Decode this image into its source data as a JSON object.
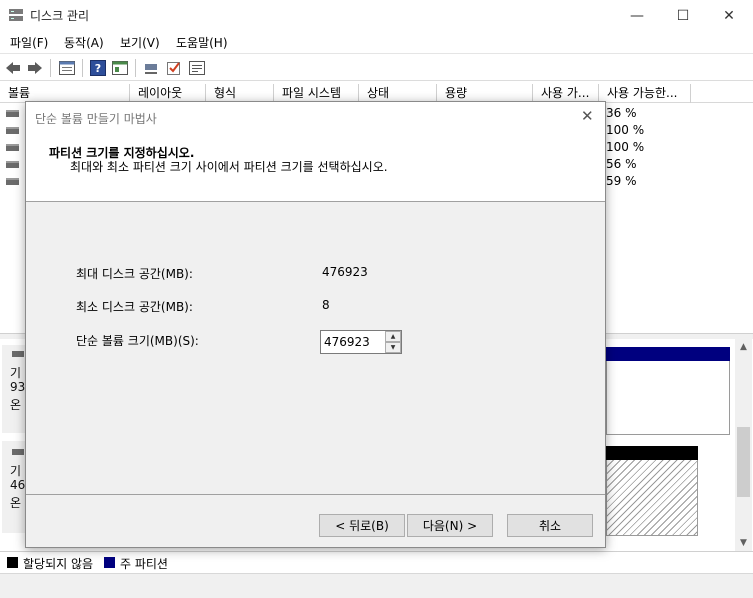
{
  "window": {
    "title": "디스크 관리",
    "controls": {
      "minimize": "—",
      "maximize": "☐",
      "close": "✕"
    }
  },
  "menu": [
    "파일(F)",
    "동작(A)",
    "보기(V)",
    "도움말(H)"
  ],
  "toolbar": [
    "back-icon",
    "forward-icon",
    "properties-icon",
    "help-icon",
    "view-icon",
    "connect-icon",
    "check-icon",
    "list-icon"
  ],
  "columns": [
    "볼륨",
    "레이아웃",
    "형식",
    "파일 시스템",
    "상태",
    "용량",
    "사용 가...",
    "사용 가능한..."
  ],
  "volumes": [
    {
      "free_pct": "36 %"
    },
    {
      "free_pct": "100 %"
    },
    {
      "free_pct": "100 %"
    },
    {
      "free_pct": "56 %"
    },
    {
      "free_pct": "59 %"
    }
  ],
  "disks": [
    {
      "line1": "기",
      "line2": "93",
      "line3": "온"
    },
    {
      "line1": "기",
      "line2": "46",
      "line3": "온"
    }
  ],
  "legend": [
    {
      "label": "할당되지 않음",
      "color": "#000000"
    },
    {
      "label": "주 파티션",
      "color": "#00007f"
    }
  ],
  "dialog": {
    "title": "단순 볼륨 만들기 마법사",
    "heading": "파티션 크기를 지정하십시오.",
    "subheading": "최대와 최소 파티션 크기 사이에서 파티션 크기를 선택하십시오.",
    "max_label": "최대 디스크 공간(MB):",
    "max_value": "476923",
    "min_label": "최소 디스크 공간(MB):",
    "min_value": "8",
    "size_label": "단순 볼륨 크기(MB)(S):",
    "size_value": "476923",
    "back_button": "< 뒤로(B)",
    "next_button": "다음(N) >",
    "cancel_button": "취소"
  }
}
